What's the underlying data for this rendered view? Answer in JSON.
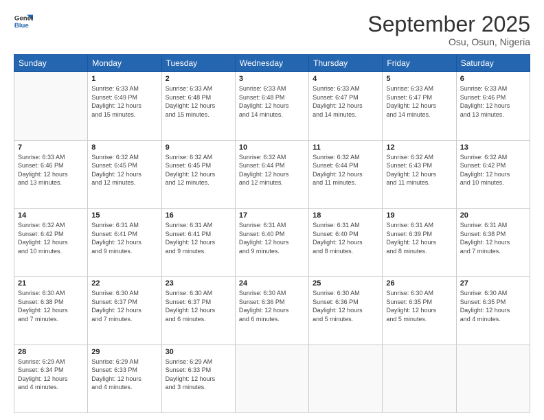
{
  "header": {
    "logo_line1": "General",
    "logo_line2": "Blue",
    "month": "September 2025",
    "location": "Osu, Osun, Nigeria"
  },
  "days_of_week": [
    "Sunday",
    "Monday",
    "Tuesday",
    "Wednesday",
    "Thursday",
    "Friday",
    "Saturday"
  ],
  "weeks": [
    [
      {
        "day": "",
        "sunrise": "",
        "sunset": "",
        "daylight": ""
      },
      {
        "day": "1",
        "sunrise": "6:33 AM",
        "sunset": "6:49 PM",
        "daylight1": "Daylight: 12 hours",
        "daylight2": "and 15 minutes."
      },
      {
        "day": "2",
        "sunrise": "6:33 AM",
        "sunset": "6:48 PM",
        "daylight1": "Daylight: 12 hours",
        "daylight2": "and 15 minutes."
      },
      {
        "day": "3",
        "sunrise": "6:33 AM",
        "sunset": "6:48 PM",
        "daylight1": "Daylight: 12 hours",
        "daylight2": "and 14 minutes."
      },
      {
        "day": "4",
        "sunrise": "6:33 AM",
        "sunset": "6:47 PM",
        "daylight1": "Daylight: 12 hours",
        "daylight2": "and 14 minutes."
      },
      {
        "day": "5",
        "sunrise": "6:33 AM",
        "sunset": "6:47 PM",
        "daylight1": "Daylight: 12 hours",
        "daylight2": "and 14 minutes."
      },
      {
        "day": "6",
        "sunrise": "6:33 AM",
        "sunset": "6:46 PM",
        "daylight1": "Daylight: 12 hours",
        "daylight2": "and 13 minutes."
      }
    ],
    [
      {
        "day": "7",
        "sunrise": "6:33 AM",
        "sunset": "6:46 PM",
        "daylight1": "Daylight: 12 hours",
        "daylight2": "and 13 minutes."
      },
      {
        "day": "8",
        "sunrise": "6:32 AM",
        "sunset": "6:45 PM",
        "daylight1": "Daylight: 12 hours",
        "daylight2": "and 12 minutes."
      },
      {
        "day": "9",
        "sunrise": "6:32 AM",
        "sunset": "6:45 PM",
        "daylight1": "Daylight: 12 hours",
        "daylight2": "and 12 minutes."
      },
      {
        "day": "10",
        "sunrise": "6:32 AM",
        "sunset": "6:44 PM",
        "daylight1": "Daylight: 12 hours",
        "daylight2": "and 12 minutes."
      },
      {
        "day": "11",
        "sunrise": "6:32 AM",
        "sunset": "6:44 PM",
        "daylight1": "Daylight: 12 hours",
        "daylight2": "and 11 minutes."
      },
      {
        "day": "12",
        "sunrise": "6:32 AM",
        "sunset": "6:43 PM",
        "daylight1": "Daylight: 12 hours",
        "daylight2": "and 11 minutes."
      },
      {
        "day": "13",
        "sunrise": "6:32 AM",
        "sunset": "6:42 PM",
        "daylight1": "Daylight: 12 hours",
        "daylight2": "and 10 minutes."
      }
    ],
    [
      {
        "day": "14",
        "sunrise": "6:32 AM",
        "sunset": "6:42 PM",
        "daylight1": "Daylight: 12 hours",
        "daylight2": "and 10 minutes."
      },
      {
        "day": "15",
        "sunrise": "6:31 AM",
        "sunset": "6:41 PM",
        "daylight1": "Daylight: 12 hours",
        "daylight2": "and 9 minutes."
      },
      {
        "day": "16",
        "sunrise": "6:31 AM",
        "sunset": "6:41 PM",
        "daylight1": "Daylight: 12 hours",
        "daylight2": "and 9 minutes."
      },
      {
        "day": "17",
        "sunrise": "6:31 AM",
        "sunset": "6:40 PM",
        "daylight1": "Daylight: 12 hours",
        "daylight2": "and 9 minutes."
      },
      {
        "day": "18",
        "sunrise": "6:31 AM",
        "sunset": "6:40 PM",
        "daylight1": "Daylight: 12 hours",
        "daylight2": "and 8 minutes."
      },
      {
        "day": "19",
        "sunrise": "6:31 AM",
        "sunset": "6:39 PM",
        "daylight1": "Daylight: 12 hours",
        "daylight2": "and 8 minutes."
      },
      {
        "day": "20",
        "sunrise": "6:31 AM",
        "sunset": "6:38 PM",
        "daylight1": "Daylight: 12 hours",
        "daylight2": "and 7 minutes."
      }
    ],
    [
      {
        "day": "21",
        "sunrise": "6:30 AM",
        "sunset": "6:38 PM",
        "daylight1": "Daylight: 12 hours",
        "daylight2": "and 7 minutes."
      },
      {
        "day": "22",
        "sunrise": "6:30 AM",
        "sunset": "6:37 PM",
        "daylight1": "Daylight: 12 hours",
        "daylight2": "and 7 minutes."
      },
      {
        "day": "23",
        "sunrise": "6:30 AM",
        "sunset": "6:37 PM",
        "daylight1": "Daylight: 12 hours",
        "daylight2": "and 6 minutes."
      },
      {
        "day": "24",
        "sunrise": "6:30 AM",
        "sunset": "6:36 PM",
        "daylight1": "Daylight: 12 hours",
        "daylight2": "and 6 minutes."
      },
      {
        "day": "25",
        "sunrise": "6:30 AM",
        "sunset": "6:36 PM",
        "daylight1": "Daylight: 12 hours",
        "daylight2": "and 5 minutes."
      },
      {
        "day": "26",
        "sunrise": "6:30 AM",
        "sunset": "6:35 PM",
        "daylight1": "Daylight: 12 hours",
        "daylight2": "and 5 minutes."
      },
      {
        "day": "27",
        "sunrise": "6:30 AM",
        "sunset": "6:35 PM",
        "daylight1": "Daylight: 12 hours",
        "daylight2": "and 4 minutes."
      }
    ],
    [
      {
        "day": "28",
        "sunrise": "6:29 AM",
        "sunset": "6:34 PM",
        "daylight1": "Daylight: 12 hours",
        "daylight2": "and 4 minutes."
      },
      {
        "day": "29",
        "sunrise": "6:29 AM",
        "sunset": "6:33 PM",
        "daylight1": "Daylight: 12 hours",
        "daylight2": "and 4 minutes."
      },
      {
        "day": "30",
        "sunrise": "6:29 AM",
        "sunset": "6:33 PM",
        "daylight1": "Daylight: 12 hours",
        "daylight2": "and 3 minutes."
      },
      {
        "day": "",
        "sunrise": "",
        "sunset": "",
        "daylight1": "",
        "daylight2": ""
      },
      {
        "day": "",
        "sunrise": "",
        "sunset": "",
        "daylight1": "",
        "daylight2": ""
      },
      {
        "day": "",
        "sunrise": "",
        "sunset": "",
        "daylight1": "",
        "daylight2": ""
      },
      {
        "day": "",
        "sunrise": "",
        "sunset": "",
        "daylight1": "",
        "daylight2": ""
      }
    ]
  ]
}
